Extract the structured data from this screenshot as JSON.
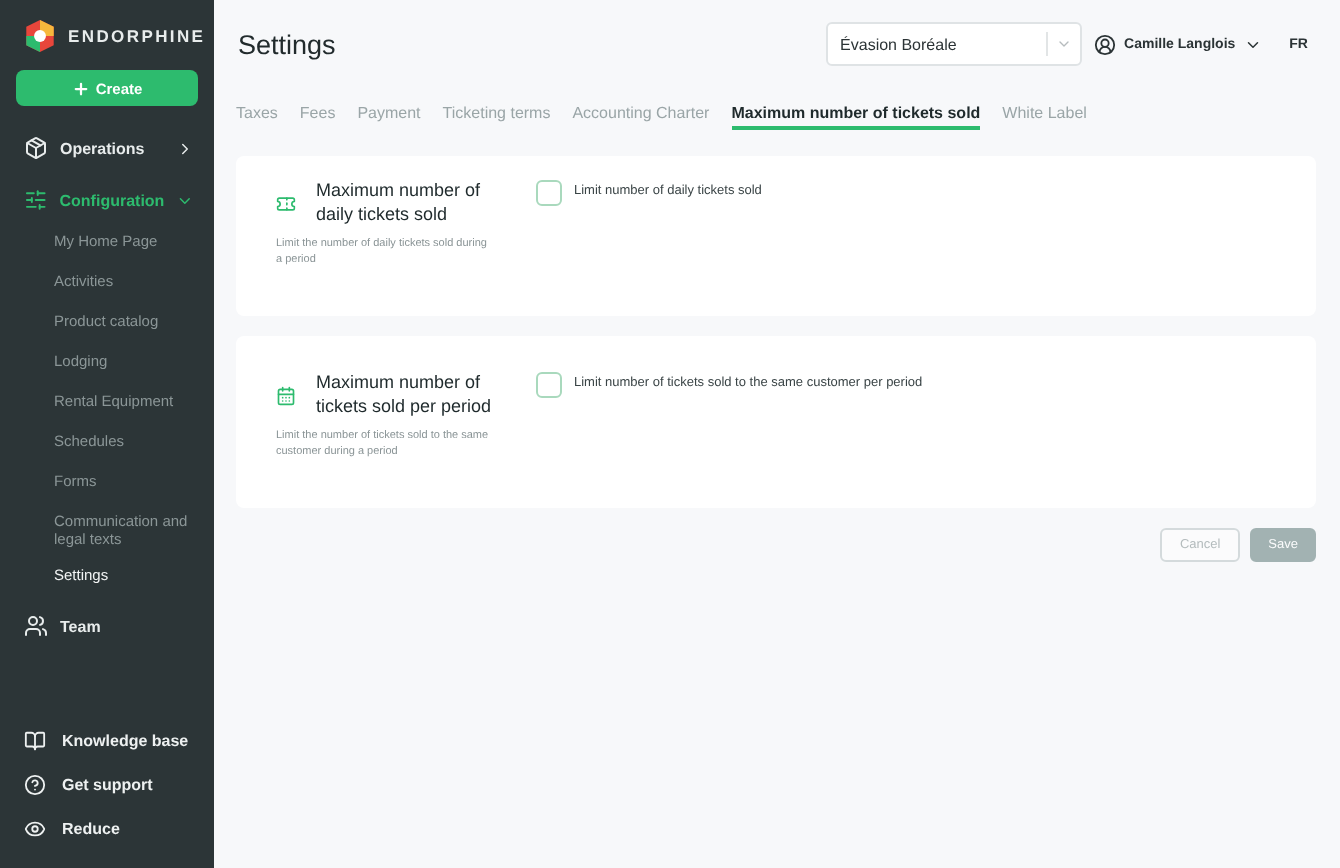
{
  "sidebar": {
    "brand": "ENDORPHINE",
    "create_button": "Create",
    "items": [
      {
        "label": "Operations",
        "expanded": false,
        "selected": false
      },
      {
        "label": "Configuration",
        "expanded": true,
        "selected": true,
        "children": [
          {
            "label": "My Home Page",
            "selected": false
          },
          {
            "label": "Activities",
            "selected": false
          },
          {
            "label": "Product catalog",
            "selected": false
          },
          {
            "label": "Lodging",
            "selected": false
          },
          {
            "label": "Rental Equipment",
            "selected": false
          },
          {
            "label": "Schedules",
            "selected": false
          },
          {
            "label": "Forms",
            "selected": false
          },
          {
            "label": "Communication and legal texts",
            "selected": false
          },
          {
            "label": "Settings",
            "selected": true
          }
        ]
      },
      {
        "label": "Team",
        "selected": false
      }
    ],
    "bottom_items": [
      {
        "label": "Knowledge base"
      },
      {
        "label": "Get support"
      },
      {
        "label": "Reduce"
      }
    ]
  },
  "header": {
    "title": "Settings",
    "organization": "Évasion Boréale",
    "user": "Camille Langlois",
    "language": "FR"
  },
  "tabs": [
    {
      "label": "Taxes",
      "selected": false
    },
    {
      "label": "Fees",
      "selected": false
    },
    {
      "label": "Payment",
      "selected": false
    },
    {
      "label": "Ticketing terms",
      "selected": false
    },
    {
      "label": "Accounting Charter",
      "selected": false
    },
    {
      "label": "Maximum number of tickets sold",
      "selected": true
    },
    {
      "label": "White Label",
      "selected": false
    }
  ],
  "sections": [
    {
      "title": "Maximum number of daily tickets sold",
      "description": "Limit the number of daily tickets sold during a period",
      "option": {
        "label": "Limit number of daily tickets sold",
        "checked": false
      }
    },
    {
      "title": "Maximum number of tickets sold per period",
      "description": "Limit the number of tickets sold to the same customer during a period",
      "option": {
        "label": "Limit number of tickets sold to the same customer per period",
        "checked": false
      }
    }
  ],
  "actions": [
    {
      "label": "Cancel",
      "kind": "secondary",
      "disabled": true
    },
    {
      "label": "Save",
      "kind": "primary",
      "disabled": true
    }
  ]
}
